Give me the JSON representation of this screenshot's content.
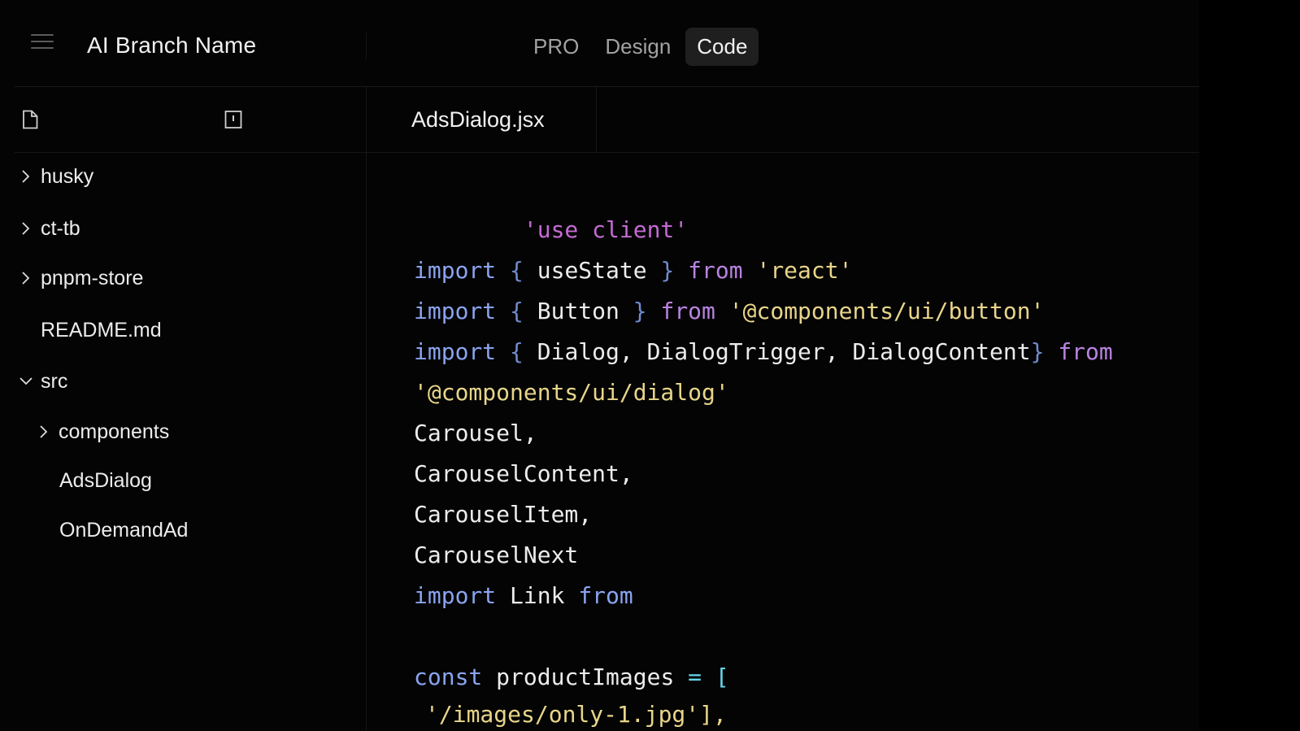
{
  "header": {
    "app_title": "AI Branch Name",
    "tabs": [
      {
        "label": "PRO",
        "active": false
      },
      {
        "label": "Design",
        "active": false
      },
      {
        "label": "Code",
        "active": true
      }
    ]
  },
  "sidebar": {
    "toolbar_icons": [
      "file-icon",
      "panel-icon"
    ],
    "tree": [
      {
        "label": "husky",
        "chevron": "right"
      },
      {
        "label": "ct-tb",
        "chevron": "right"
      },
      {
        "label": "pnpm-store",
        "chevron": "right"
      },
      {
        "label": "README.md",
        "chevron": ""
      },
      {
        "label": "src",
        "chevron": "down"
      },
      {
        "label": "components",
        "chevron": "right"
      },
      {
        "label": "AdsDialog",
        "chevron": ""
      },
      {
        "label": "OnDemandAd",
        "chevron": ""
      }
    ]
  },
  "editor": {
    "active_file": "AdsDialog.jsx",
    "code": {
      "l1": "'use client'",
      "l2_kw": "import",
      "l2_open": "{",
      "l2_id": "useState",
      "l2_close": "}",
      "l2_from": "from",
      "l2_str": "'react'",
      "l3_kw": "import",
      "l3_open": "{",
      "l3_id": "Button",
      "l3_close": "}",
      "l3_from": "from",
      "l3_str": "'@components/ui/button'",
      "l4_kw": "import",
      "l4_open": "{",
      "l4_id": "Dialog, DialogTrigger, DialogContent",
      "l4_close": "}",
      "l4_from": "from",
      "l5": "'@components/ui/dialog'",
      "l6": "Carousel,",
      "l7": "CarouselContent,",
      "l8": "CarouselItem,",
      "l9": "CarouselNext",
      "l10_kw": "import",
      "l10_id": "Link",
      "l10_from": "from",
      "l11_kw": "const",
      "l11_id": "productImages",
      "l11_op": "=",
      "l11_bracket": "[",
      "l12": "'/images/only-1.jpg'],"
    }
  },
  "colors": {
    "background": "#040404",
    "keyword": "#8aa4ef",
    "from": "#b983e0",
    "string": "#e8d58a",
    "use_client": "#c46bd3",
    "active_tab_bg": "#1f1f1f"
  }
}
